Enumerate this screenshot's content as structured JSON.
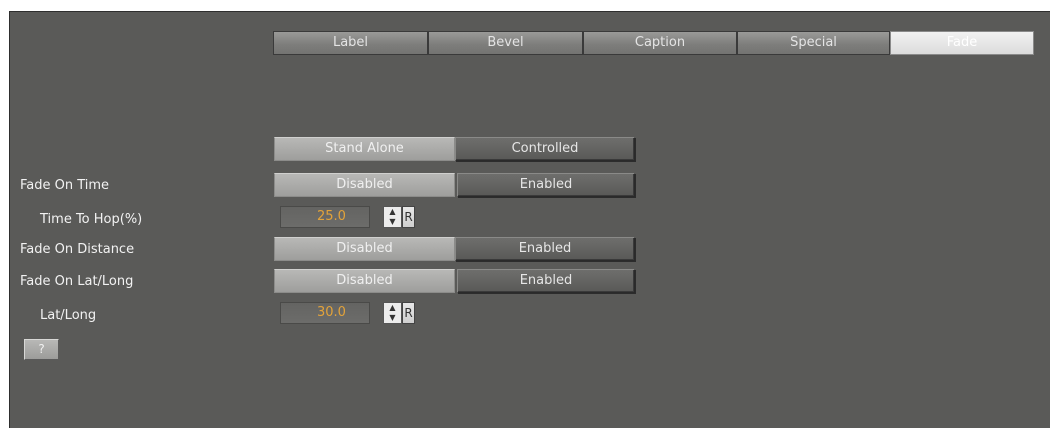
{
  "tabs": [
    "Label",
    "Bevel",
    "Caption",
    "Special",
    "Fade"
  ],
  "active_tab": "Fade",
  "mode": {
    "options": [
      "Stand Alone",
      "Controlled"
    ],
    "selected": "Stand Alone"
  },
  "rows": {
    "fade_on_time": {
      "label": "Fade On Time",
      "off": "Disabled",
      "on": "Enabled",
      "selected": "Disabled"
    },
    "time_to_hop": {
      "label": "Time To Hop(%)",
      "value": "25.0",
      "reset": "R"
    },
    "fade_on_distance": {
      "label": "Fade On Distance",
      "off": "Disabled",
      "on": "Enabled",
      "selected": "Disabled"
    },
    "fade_on_latlong": {
      "label": "Fade On Lat/Long",
      "off": "Disabled",
      "on": "Enabled",
      "selected": "Disabled"
    },
    "latlong": {
      "label": "Lat/Long",
      "value": "30.0",
      "reset": "R"
    }
  },
  "help_label": "?",
  "colors": {
    "panel_bg": "#5a5a58",
    "value_text": "#e3a33a",
    "label_text": "#f2f2f2"
  },
  "icons": {
    "spinner_up": "up-arrow-icon",
    "spinner_down": "down-arrow-icon"
  }
}
